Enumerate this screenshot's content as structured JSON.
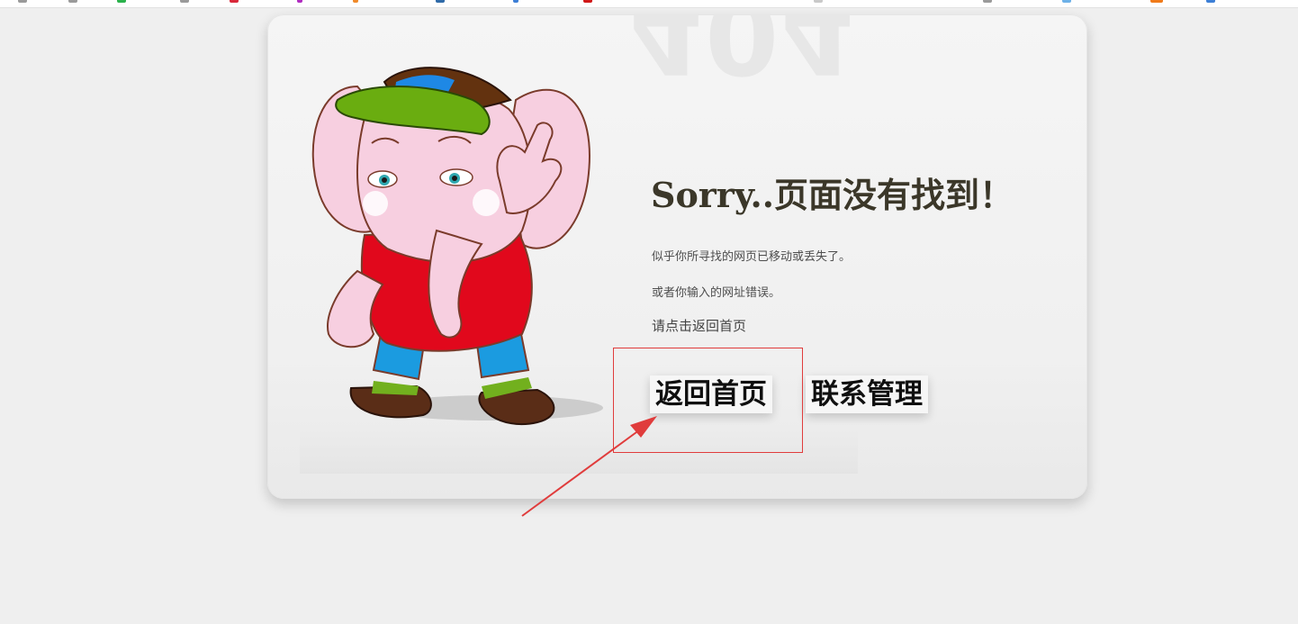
{
  "page": {
    "background_number": "404",
    "heading": "Sorry..页面没有找到！",
    "message_line1": "似乎你所寻找的网页已移动或丢失了。",
    "message_line2": "或者你输入的网址错误。",
    "hint": "请点击返回首页",
    "buttons": {
      "home_label": "返回首页",
      "contact_label": "联系管理"
    }
  },
  "illustration": {
    "subject": "cartoon-pink-elephant-waving",
    "icon": "elephant-mascot"
  },
  "annotation": {
    "highlight_color": "#e03c3c",
    "arrow_color": "#e03c3c"
  },
  "colors": {
    "page_bg": "#efefef",
    "heading": "#3b3729",
    "text": "#4e4e4e"
  }
}
